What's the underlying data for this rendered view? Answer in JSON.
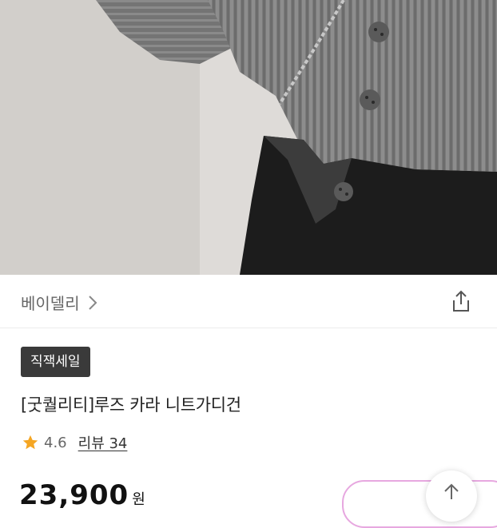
{
  "brand": {
    "name": "베이델리"
  },
  "product": {
    "badge": "직잭세일",
    "title": "[굿퀄리티]루즈 카라 니트가디건",
    "rating": "4.6",
    "reviews_label": "리뷰 34",
    "price": "23,900",
    "currency": "원"
  },
  "colors": {
    "star": "#f5a623",
    "badge_bg": "#3a3a3a",
    "coupon_border": "#e7a8e0"
  },
  "icons": {
    "share": "share-icon",
    "chevron": "chevron-right-icon",
    "star": "star-icon",
    "top": "arrow-up-icon"
  }
}
